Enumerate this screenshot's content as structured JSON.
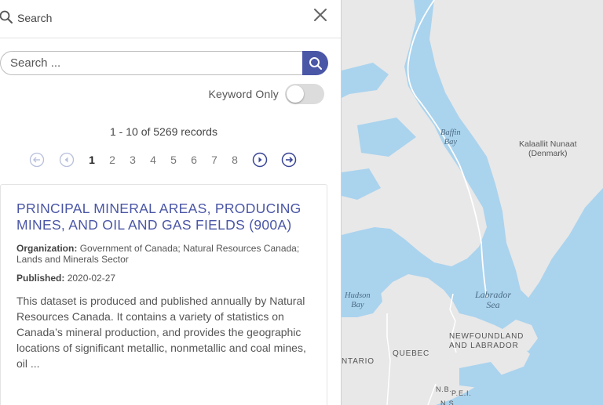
{
  "header": {
    "title": "Search",
    "search_icon": "search-icon",
    "close_icon": "close-icon"
  },
  "search": {
    "placeholder": "Search ...",
    "value": "",
    "button_icon": "search-icon",
    "accent": "#4a56a6"
  },
  "keyword": {
    "label": "Keyword Only",
    "enabled": false
  },
  "records_text": "1 - 10 of 5269 records",
  "pagination": {
    "pages": [
      "1",
      "2",
      "3",
      "4",
      "5",
      "6",
      "7",
      "8"
    ],
    "current": "1",
    "icons": [
      "first-page-icon",
      "prev-page-icon",
      "next-page-icon",
      "last-page-icon"
    ]
  },
  "result": {
    "title": "PRINCIPAL MINERAL AREAS, PRODUCING MINES, AND OIL AND GAS FIELDS (900A)",
    "org_label": "Organization:",
    "org_value": "Government of Canada; Natural Resources Canada; Lands and Minerals Sector",
    "pub_label": "Published:",
    "pub_value": "2020-02-27",
    "description": "This dataset is produced and published annually by Natural Resources Canada. It contains a variety of statistics on Canada’s mineral production, and provides the geographic locations of significant metallic, nonmetallic and coal mines, oil ..."
  },
  "map": {
    "labels": {
      "baffin_bay_1": "Baffin",
      "baffin_bay_2": "Bay",
      "greenland_1": "Kalaallit Nunaat",
      "greenland_2": "(Denmark)",
      "labrador_sea_1": "Labrador",
      "labrador_sea_2": "Sea",
      "hudson_bay_1": "Hudson",
      "hudson_bay_2": "Bay",
      "nl_1": "NEWFOUNDLAND",
      "nl_2": "AND LABRADOR",
      "quebec": "QUEBEC",
      "ontario": "NTARIO",
      "nb": "N.B.",
      "pei": "P.E.I.",
      "ns": "N.S."
    },
    "water_color": "#aad3ee",
    "land_color": "#e8e8e8"
  }
}
